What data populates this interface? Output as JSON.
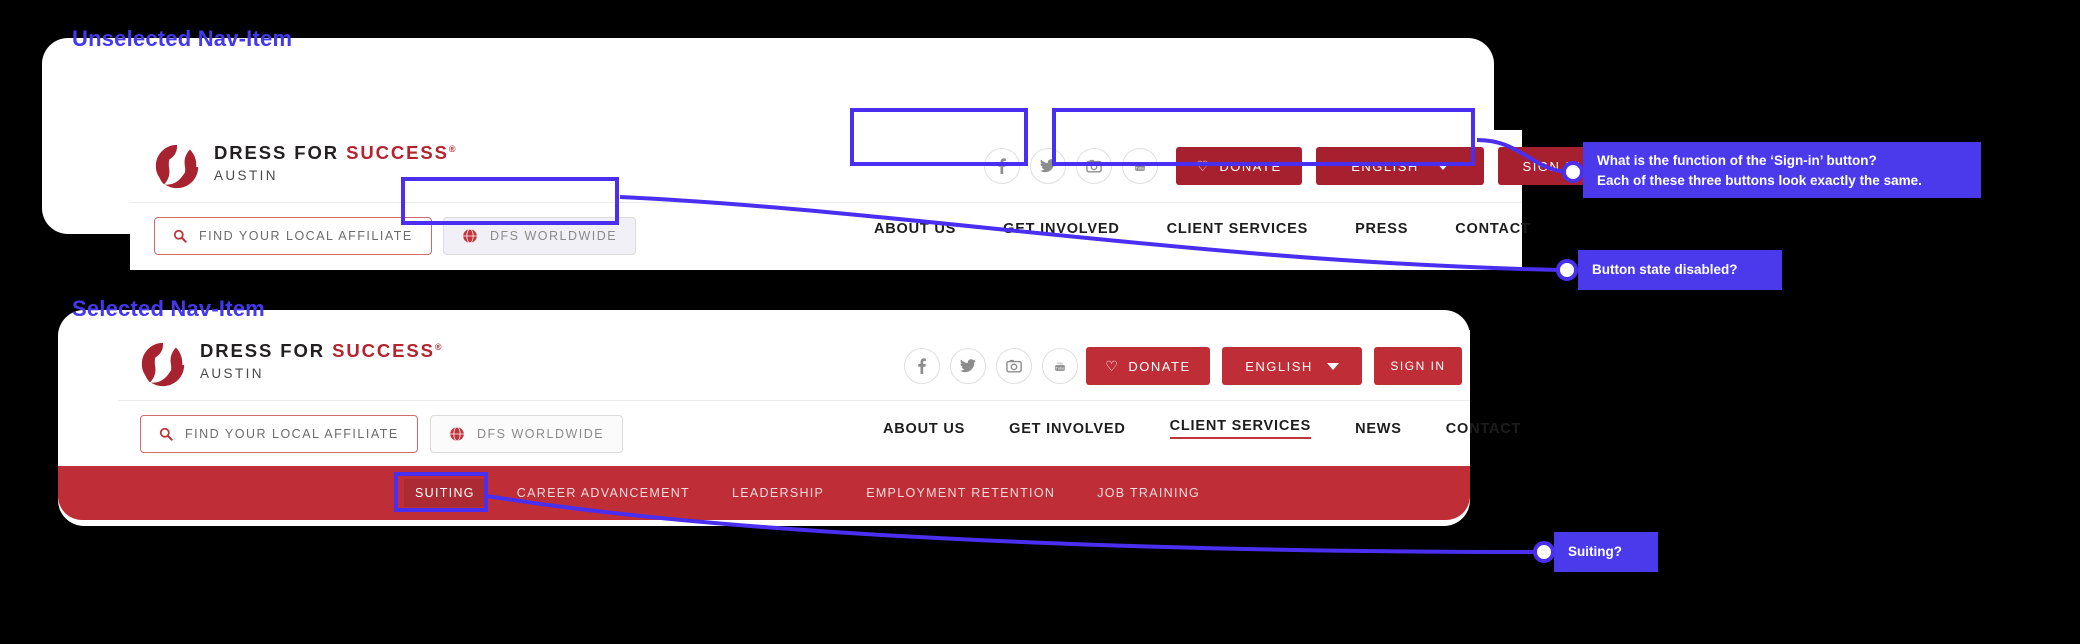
{
  "annotations": {
    "title_unselected": "Unselected Nav-Item",
    "title_selected": "Selected Nav-Item",
    "note_signin": "What is the function of the ‘Sign-in’ button?\nEach of these three buttons look exactly the same.",
    "note_disabled": "Button state disabled?",
    "note_suiting": "Suiting?",
    "accent_color": "#4a2ff0"
  },
  "brand": {
    "name_part1": "DRESS FOR ",
    "name_part2": "SUCCESS",
    "registered": "®",
    "chapter": "AUSTIN",
    "brand_red": "#b4232f"
  },
  "header_unselected": {
    "search_button": "FIND YOUR LOCAL AFFILIATE",
    "worldwide_button": "DFS WORLDWIDE",
    "social": [
      {
        "name": "facebook-icon",
        "glyph": "f"
      },
      {
        "name": "twitter-icon",
        "glyph": "t"
      },
      {
        "name": "instagram-icon",
        "glyph": "i"
      },
      {
        "name": "youtube-icon",
        "glyph": "y"
      }
    ],
    "donate_button": "DONATE",
    "language_select": "ENGLISH",
    "signin_button": "SIGN IN",
    "nav": [
      {
        "label": "ABOUT US",
        "selected": false
      },
      {
        "label": "GET INVOLVED",
        "selected": false
      },
      {
        "label": "CLIENT SERVICES",
        "selected": false
      },
      {
        "label": "PRESS",
        "selected": false
      },
      {
        "label": "CONTACT",
        "selected": false
      }
    ],
    "button_red": "#a72030"
  },
  "header_selected": {
    "search_button": "FIND YOUR LOCAL AFFILIATE",
    "worldwide_button": "DFS WORLDWIDE",
    "donate_button": "DONATE",
    "language_select": "ENGLISH",
    "signin_button": "SIGN IN",
    "nav": [
      {
        "label": "ABOUT US",
        "selected": false
      },
      {
        "label": "GET INVOLVED",
        "selected": false
      },
      {
        "label": "CLIENT SERVICES",
        "selected": true
      },
      {
        "label": "NEWS",
        "selected": false
      },
      {
        "label": "CONTACT",
        "selected": false
      }
    ],
    "subnav": [
      {
        "label": "SUITING",
        "selected": true
      },
      {
        "label": "CAREER ADVANCEMENT",
        "selected": false
      },
      {
        "label": "LEADERSHIP",
        "selected": false
      },
      {
        "label": "EMPLOYMENT RETENTION",
        "selected": false
      },
      {
        "label": "JOB TRAINING",
        "selected": false
      }
    ],
    "button_red": "#bf2e36",
    "subnav_bg": "#bf2e36"
  }
}
